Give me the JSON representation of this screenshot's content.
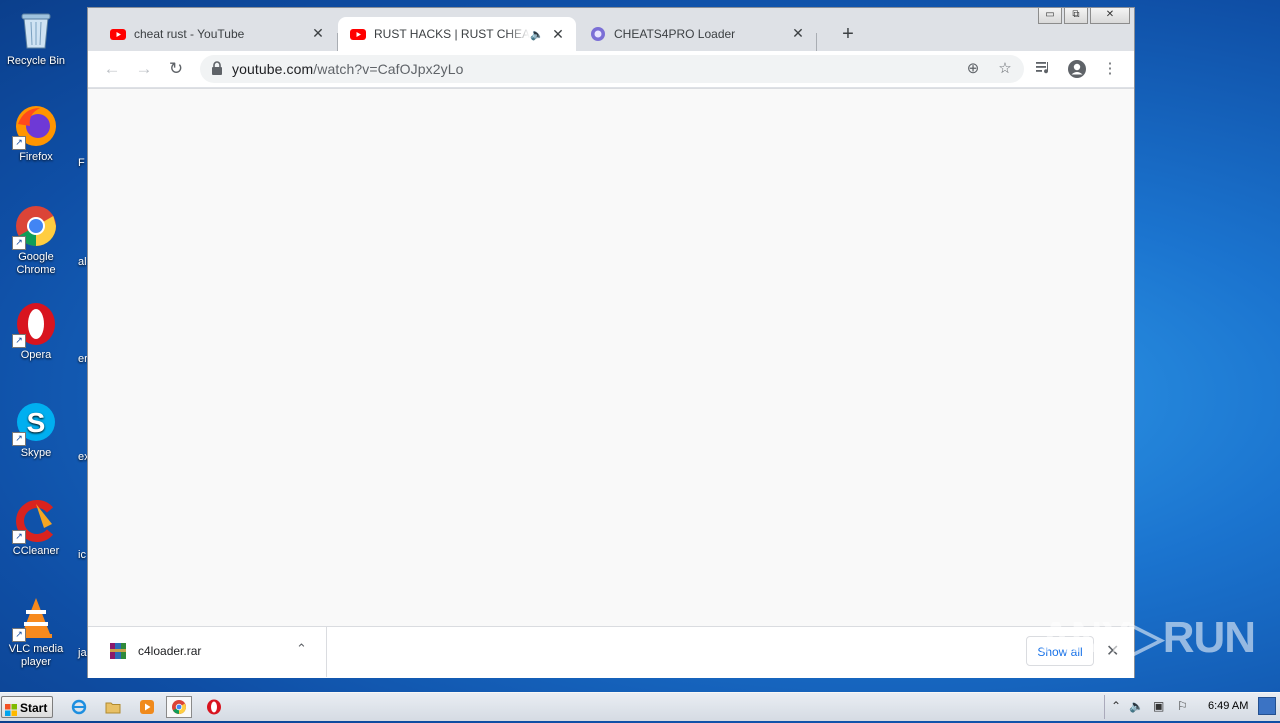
{
  "desktop": {
    "icons": [
      {
        "label": "Recycle Bin"
      },
      {
        "label": "Firefox"
      },
      {
        "label": "Google Chrome"
      },
      {
        "label": "Opera"
      },
      {
        "label": "Skype"
      },
      {
        "label": "CCleaner"
      },
      {
        "label": "VLC media player"
      }
    ],
    "partial_labels": [
      "F",
      "al",
      "er",
      "ex",
      "ic",
      "ja"
    ]
  },
  "browser": {
    "window_buttons": {
      "minimize": "▭",
      "maximize": "⧉",
      "close": "✕"
    },
    "tabs": [
      {
        "title": "cheat rust - YouTube",
        "favicon": "youtube-icon",
        "active": false
      },
      {
        "title": "RUST HACKS | RUST CHEATS FREE",
        "favicon": "youtube-icon",
        "active": true,
        "audio": "🔈"
      },
      {
        "title": "CHEATS4PRO Loader",
        "favicon": "cheats4pro-icon",
        "active": false
      }
    ],
    "tab_close": "✕",
    "new_tab": "+",
    "toolbar": {
      "back": "←",
      "forward": "→",
      "reload": "↻",
      "url_host": "youtube.com",
      "url_path": "/watch?v=CafOJpx2yLo"
    },
    "download": {
      "filename": "c4loader.rar",
      "show_all": "Show all",
      "chevron": "⌃",
      "close": "✕"
    }
  },
  "watermark": "ANY▷RUN",
  "taskbar": {
    "start_label": "Start",
    "clock": "6:49 AM"
  },
  "colors": {
    "youtube_red": "#ff0000",
    "chrome_frame": "#dee1e6",
    "link_blue": "#1a73e8"
  }
}
